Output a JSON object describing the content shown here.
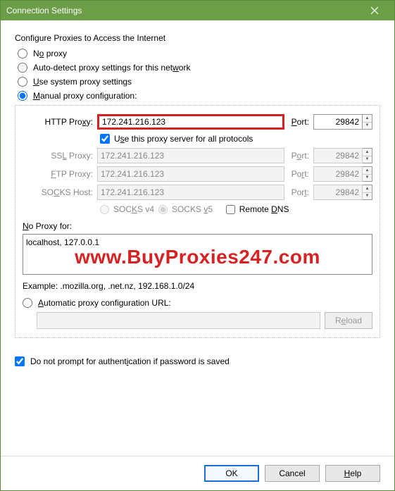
{
  "title": "Connection Settings",
  "heading": "Configure Proxies to Access the Internet",
  "options": {
    "no_proxy": "No proxy",
    "auto_detect": "Auto-detect proxy settings for this network",
    "use_system": "Use system proxy settings",
    "manual": "Manual proxy configuration:",
    "auto_url": "Automatic proxy configuration URL:"
  },
  "http": {
    "label": "HTTP Proxy:",
    "value": "172.241.216.123",
    "portlbl": "Port:",
    "port": "29842"
  },
  "use_all": "Use this proxy server for all protocols",
  "ssl": {
    "label": "SSL Proxy:",
    "value": "172.241.216.123",
    "portlbl": "Port:",
    "port": "29842"
  },
  "ftp": {
    "label": "FTP Proxy:",
    "value": "172.241.216.123",
    "portlbl": "Port:",
    "port": "29842"
  },
  "socks": {
    "label": "SOCKS Host:",
    "value": "172.241.216.123",
    "portlbl": "Port:",
    "port": "29842"
  },
  "socks_v4": "SOCKS v4",
  "socks_v5": "SOCKS v5",
  "remote_dns": "Remote DNS",
  "noproxy_label": "No Proxy for:",
  "noproxy_value": "localhost, 127.0.0.1",
  "example": "Example: .mozilla.org, .net.nz, 192.168.1.0/24",
  "reload": "Reload",
  "auth_prompt": "Do not prompt for authentication if password is saved",
  "buttons": {
    "ok": "OK",
    "cancel": "Cancel",
    "help": "Help"
  },
  "watermark": "www.BuyProxies247.com"
}
